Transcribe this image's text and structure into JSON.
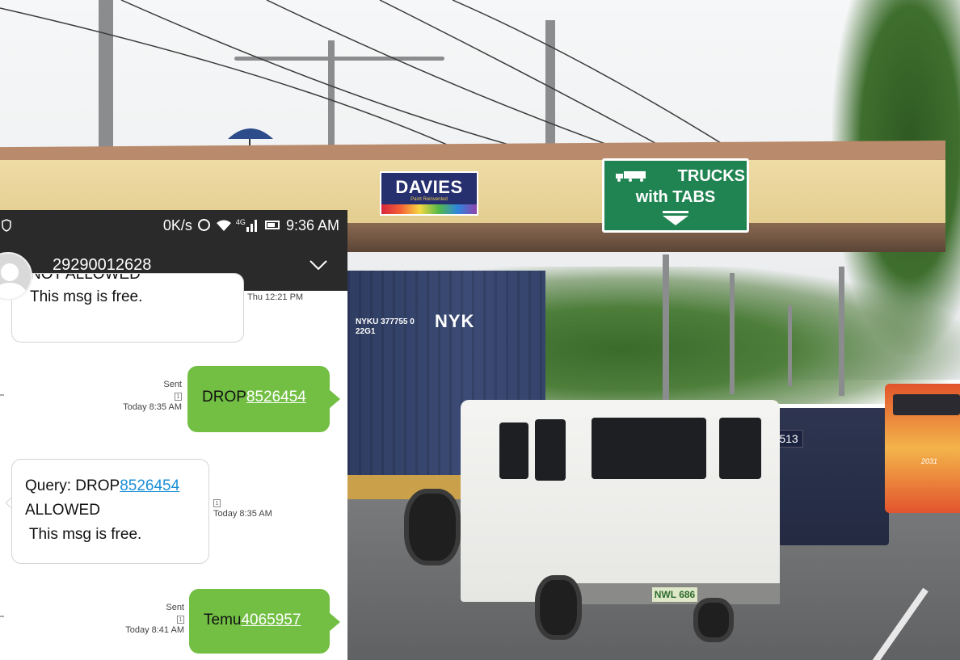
{
  "scene": {
    "sign_davies": "DAVIES",
    "sign_davies_tagline": "Paint Reinvented",
    "sign_trucks_line1": "TRUCKS",
    "sign_trucks_line2": "with TABS",
    "container_id_line1": "NYKU  377755 0",
    "container_id_line2": "22G1",
    "container_logo": "NYK",
    "plate": "NWL 686",
    "armored_number": "513",
    "bus_number": "2031",
    "colors": {
      "sign_green": "#1f8452",
      "davies_blue": "#27306f",
      "bridge": "#efdca5"
    }
  },
  "phone": {
    "status": {
      "speed": "0K/s",
      "network": "4G",
      "time": "9:36 AM",
      "icons": [
        "shield-icon",
        "alarm-icon",
        "wifi-icon",
        "signal-icon",
        "battery-icon"
      ]
    },
    "header": {
      "contact": "29290012628",
      "icons": [
        "avatar-icon",
        "chevron-down-icon"
      ]
    },
    "messages": [
      {
        "direction": "in",
        "text_partial": "NOT ALLOWED",
        "text_line2": "This msg is free.",
        "time": "Thu 12:21 PM"
      },
      {
        "direction": "out",
        "prefix": "DROP",
        "number": "8526454",
        "status": "Sent",
        "sim": "1",
        "time": "Today 8:35 AM"
      },
      {
        "direction": "in",
        "line1_prefix": "Query: DROP",
        "line1_number": "8526454",
        "line2": "ALLOWED",
        "line3": " This msg is free.",
        "sim": "1",
        "time": "Today 8:35 AM"
      },
      {
        "direction": "out",
        "prefix": "Temu",
        "number": "4065957",
        "status": "Sent",
        "sim": "1",
        "time": "Today 8:41 AM"
      }
    ],
    "colors": {
      "bar": "#2a2a2a",
      "bubble_out": "#72bf44",
      "link": "#1b8fd6"
    }
  }
}
